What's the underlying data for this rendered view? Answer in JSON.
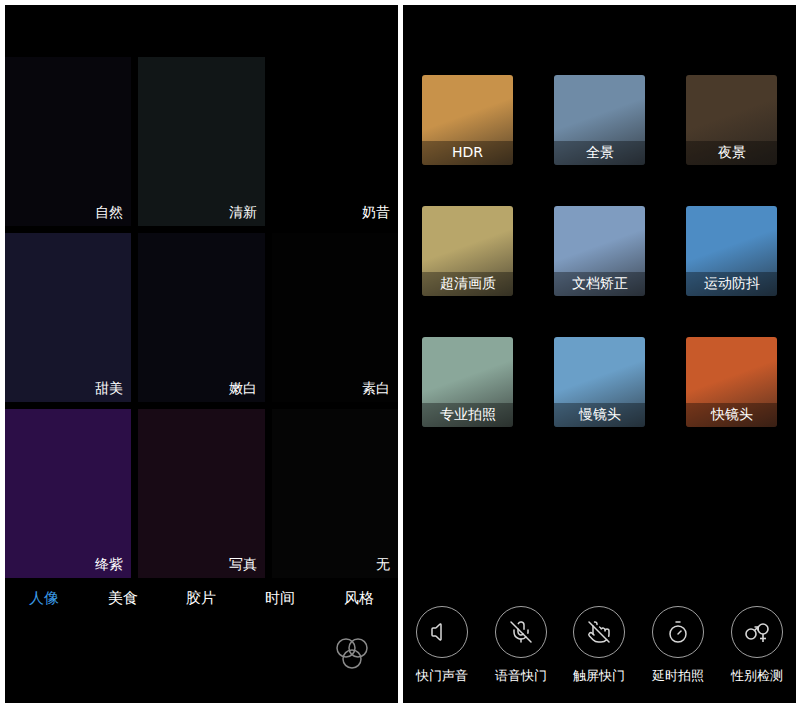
{
  "filters": {
    "tiles": [
      {
        "label": "自然",
        "color": "#07060c"
      },
      {
        "label": "清新",
        "color": "#111617"
      },
      {
        "label": "奶昔",
        "color": "#000000"
      },
      {
        "label": "甜美",
        "color": "#16152b"
      },
      {
        "label": "嫩白",
        "color": "#08080f"
      },
      {
        "label": "素白",
        "color": "#020202"
      },
      {
        "label": "绛紫",
        "color": "#2c0e47"
      },
      {
        "label": "写真",
        "color": "#180a15"
      },
      {
        "label": "无",
        "color": "#050505"
      }
    ],
    "categories": [
      {
        "label": "人像",
        "selected": true
      },
      {
        "label": "美食",
        "selected": false
      },
      {
        "label": "胶片",
        "selected": false
      },
      {
        "label": "时间",
        "selected": false
      },
      {
        "label": "风格",
        "selected": false
      }
    ]
  },
  "modes": [
    {
      "label": "HDR",
      "color": "#c8924a"
    },
    {
      "label": "全景",
      "color": "#6f8ba6"
    },
    {
      "label": "夜景",
      "color": "#4a3a2a"
    },
    {
      "label": "超清画质",
      "color": "#b8a66a"
    },
    {
      "label": "文档矫正",
      "color": "#7f9cc0"
    },
    {
      "label": "运动防抖",
      "color": "#4d8cc4"
    },
    {
      "label": "专业拍照",
      "color": "#8aa79a"
    },
    {
      "label": "慢镜头",
      "color": "#6a9fc8"
    },
    {
      "label": "快镜头",
      "color": "#c85a2a"
    }
  ],
  "toggles": [
    {
      "label": "快门声音"
    },
    {
      "label": "语音快门"
    },
    {
      "label": "触屏快门"
    },
    {
      "label": "延时拍照"
    },
    {
      "label": "性别检测"
    }
  ]
}
